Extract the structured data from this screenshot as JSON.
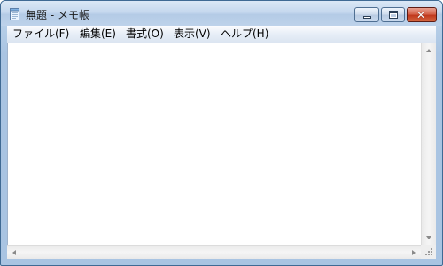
{
  "window": {
    "title": "無題 - メモ帳"
  },
  "menubar": {
    "items": [
      {
        "label": "ファイル(F)"
      },
      {
        "label": "編集(E)"
      },
      {
        "label": "書式(O)"
      },
      {
        "label": "表示(V)"
      },
      {
        "label": "ヘルプ(H)"
      }
    ]
  },
  "editor": {
    "content": ""
  },
  "icons": {
    "app": "notepad-icon",
    "minimize": "minimize-icon",
    "maximize": "maximize-icon",
    "close": "close-icon",
    "scroll_up": "arrow-up-icon",
    "scroll_down": "arrow-down-icon",
    "scroll_left": "arrow-left-icon",
    "scroll_right": "arrow-right-icon",
    "resize": "resize-grip-icon"
  },
  "colors": {
    "frame": "#a9c4e2",
    "close_button": "#c0391d",
    "editor_background": "#ffffff"
  }
}
